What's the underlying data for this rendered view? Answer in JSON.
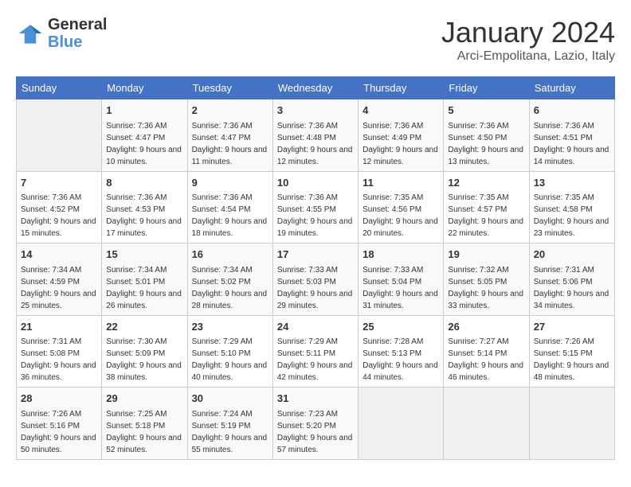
{
  "header": {
    "logo_line1": "General",
    "logo_line2": "Blue",
    "month": "January 2024",
    "location": "Arci-Empolitana, Lazio, Italy"
  },
  "weekdays": [
    "Sunday",
    "Monday",
    "Tuesday",
    "Wednesday",
    "Thursday",
    "Friday",
    "Saturday"
  ],
  "weeks": [
    [
      {
        "day": "",
        "sunrise": "",
        "sunset": "",
        "daylight": ""
      },
      {
        "day": "1",
        "sunrise": "7:36 AM",
        "sunset": "4:47 PM",
        "daylight": "9 hours and 10 minutes."
      },
      {
        "day": "2",
        "sunrise": "7:36 AM",
        "sunset": "4:47 PM",
        "daylight": "9 hours and 11 minutes."
      },
      {
        "day": "3",
        "sunrise": "7:36 AM",
        "sunset": "4:48 PM",
        "daylight": "9 hours and 12 minutes."
      },
      {
        "day": "4",
        "sunrise": "7:36 AM",
        "sunset": "4:49 PM",
        "daylight": "9 hours and 12 minutes."
      },
      {
        "day": "5",
        "sunrise": "7:36 AM",
        "sunset": "4:50 PM",
        "daylight": "9 hours and 13 minutes."
      },
      {
        "day": "6",
        "sunrise": "7:36 AM",
        "sunset": "4:51 PM",
        "daylight": "9 hours and 14 minutes."
      }
    ],
    [
      {
        "day": "7",
        "sunrise": "7:36 AM",
        "sunset": "4:52 PM",
        "daylight": "9 hours and 15 minutes."
      },
      {
        "day": "8",
        "sunrise": "7:36 AM",
        "sunset": "4:53 PM",
        "daylight": "9 hours and 17 minutes."
      },
      {
        "day": "9",
        "sunrise": "7:36 AM",
        "sunset": "4:54 PM",
        "daylight": "9 hours and 18 minutes."
      },
      {
        "day": "10",
        "sunrise": "7:36 AM",
        "sunset": "4:55 PM",
        "daylight": "9 hours and 19 minutes."
      },
      {
        "day": "11",
        "sunrise": "7:35 AM",
        "sunset": "4:56 PM",
        "daylight": "9 hours and 20 minutes."
      },
      {
        "day": "12",
        "sunrise": "7:35 AM",
        "sunset": "4:57 PM",
        "daylight": "9 hours and 22 minutes."
      },
      {
        "day": "13",
        "sunrise": "7:35 AM",
        "sunset": "4:58 PM",
        "daylight": "9 hours and 23 minutes."
      }
    ],
    [
      {
        "day": "14",
        "sunrise": "7:34 AM",
        "sunset": "4:59 PM",
        "daylight": "9 hours and 25 minutes."
      },
      {
        "day": "15",
        "sunrise": "7:34 AM",
        "sunset": "5:01 PM",
        "daylight": "9 hours and 26 minutes."
      },
      {
        "day": "16",
        "sunrise": "7:34 AM",
        "sunset": "5:02 PM",
        "daylight": "9 hours and 28 minutes."
      },
      {
        "day": "17",
        "sunrise": "7:33 AM",
        "sunset": "5:03 PM",
        "daylight": "9 hours and 29 minutes."
      },
      {
        "day": "18",
        "sunrise": "7:33 AM",
        "sunset": "5:04 PM",
        "daylight": "9 hours and 31 minutes."
      },
      {
        "day": "19",
        "sunrise": "7:32 AM",
        "sunset": "5:05 PM",
        "daylight": "9 hours and 33 minutes."
      },
      {
        "day": "20",
        "sunrise": "7:31 AM",
        "sunset": "5:06 PM",
        "daylight": "9 hours and 34 minutes."
      }
    ],
    [
      {
        "day": "21",
        "sunrise": "7:31 AM",
        "sunset": "5:08 PM",
        "daylight": "9 hours and 36 minutes."
      },
      {
        "day": "22",
        "sunrise": "7:30 AM",
        "sunset": "5:09 PM",
        "daylight": "9 hours and 38 minutes."
      },
      {
        "day": "23",
        "sunrise": "7:29 AM",
        "sunset": "5:10 PM",
        "daylight": "9 hours and 40 minutes."
      },
      {
        "day": "24",
        "sunrise": "7:29 AM",
        "sunset": "5:11 PM",
        "daylight": "9 hours and 42 minutes."
      },
      {
        "day": "25",
        "sunrise": "7:28 AM",
        "sunset": "5:13 PM",
        "daylight": "9 hours and 44 minutes."
      },
      {
        "day": "26",
        "sunrise": "7:27 AM",
        "sunset": "5:14 PM",
        "daylight": "9 hours and 46 minutes."
      },
      {
        "day": "27",
        "sunrise": "7:26 AM",
        "sunset": "5:15 PM",
        "daylight": "9 hours and 48 minutes."
      }
    ],
    [
      {
        "day": "28",
        "sunrise": "7:26 AM",
        "sunset": "5:16 PM",
        "daylight": "9 hours and 50 minutes."
      },
      {
        "day": "29",
        "sunrise": "7:25 AM",
        "sunset": "5:18 PM",
        "daylight": "9 hours and 52 minutes."
      },
      {
        "day": "30",
        "sunrise": "7:24 AM",
        "sunset": "5:19 PM",
        "daylight": "9 hours and 55 minutes."
      },
      {
        "day": "31",
        "sunrise": "7:23 AM",
        "sunset": "5:20 PM",
        "daylight": "9 hours and 57 minutes."
      },
      {
        "day": "",
        "sunrise": "",
        "sunset": "",
        "daylight": ""
      },
      {
        "day": "",
        "sunrise": "",
        "sunset": "",
        "daylight": ""
      },
      {
        "day": "",
        "sunrise": "",
        "sunset": "",
        "daylight": ""
      }
    ]
  ]
}
